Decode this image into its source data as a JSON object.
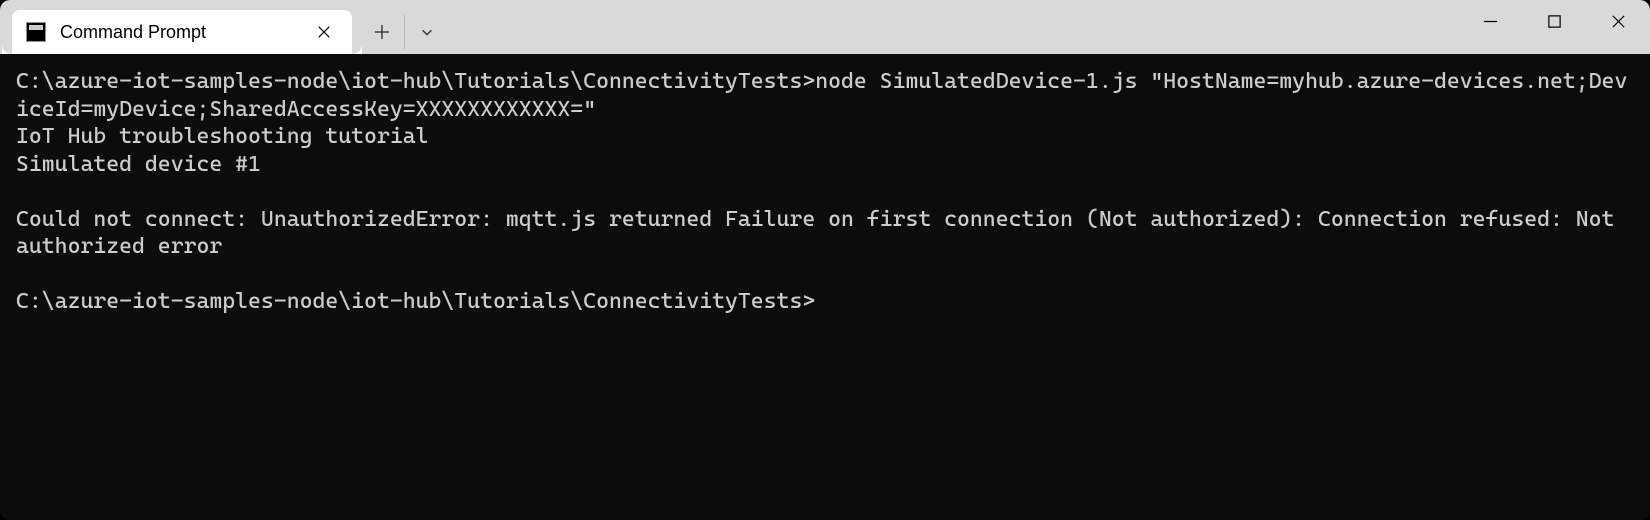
{
  "tab": {
    "title": "Command Prompt"
  },
  "terminal": {
    "line1": "C:\\azure-iot-samples-node\\iot-hub\\Tutorials\\ConnectivityTests>node SimulatedDevice-1.js \"HostName=myhub.azure-devices.net;DeviceId=myDevice;SharedAccessKey=XXXXXXXXXXXX=\"",
    "line2": "IoT Hub troubleshooting tutorial",
    "line3": "Simulated device #1",
    "line4": "",
    "line5": "Could not connect: UnauthorizedError: mqtt.js returned Failure on first connection (Not authorized): Connection refused: Not authorized error",
    "line6": "",
    "line7": "C:\\azure-iot-samples-node\\iot-hub\\Tutorials\\ConnectivityTests>"
  }
}
